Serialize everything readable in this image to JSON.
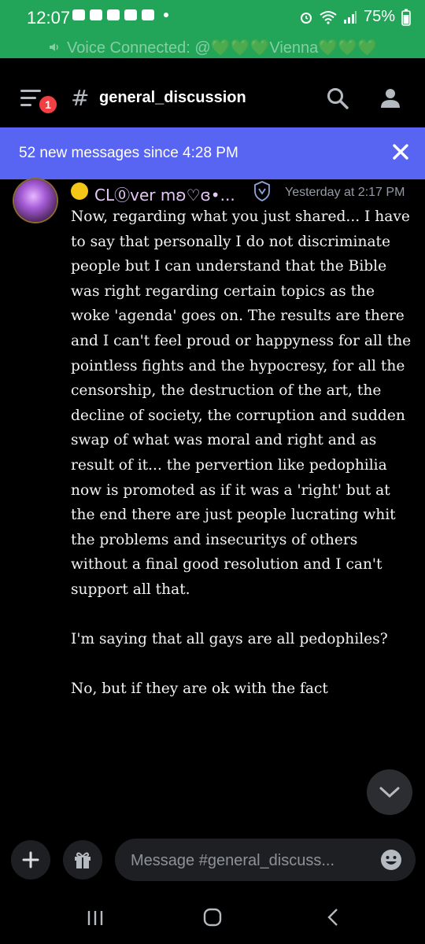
{
  "status_bar": {
    "time": "12:07",
    "battery": "75%"
  },
  "voice_banner": {
    "text": "Voice Connected: @💚💚💚Vienna💚💚💚"
  },
  "header": {
    "notification_badge": "1",
    "channel_name": "general_discussion"
  },
  "new_messages_bar": {
    "text": "52 new messages since 4:28 PM"
  },
  "message": {
    "author": "CL⓪ver mʚ♡ɞ•...",
    "timestamp": "Yesterday at 2:17 PM",
    "paragraphs": [
      "Now, regarding what you just shared... I have to say that personally I do not discriminate people but I can understand that the Bible was right regarding certain topics as the woke 'agenda' goes on. The results are there and I can't feel proud or happyness for all the pointless fights and the hypocresy, for all the censorship, the destruction of the art, the decline of society, the corruption and sudden swap of what was moral and right and as result of it... the pervertion like pedophilia now is promoted as if it was a 'right' but at the end there are just people lucrating whit the problems and insecuritys of others without a final good resolution and I can't support all that.",
      "I'm saying that all gays are all pedophiles?",
      "No, but if they are ok with the fact"
    ]
  },
  "composer": {
    "placeholder": "Message #general_discuss..."
  },
  "colors": {
    "voice_green": "#23a559",
    "blurple": "#5865f2",
    "background": "#000000",
    "badge_red": "#f23f43"
  }
}
